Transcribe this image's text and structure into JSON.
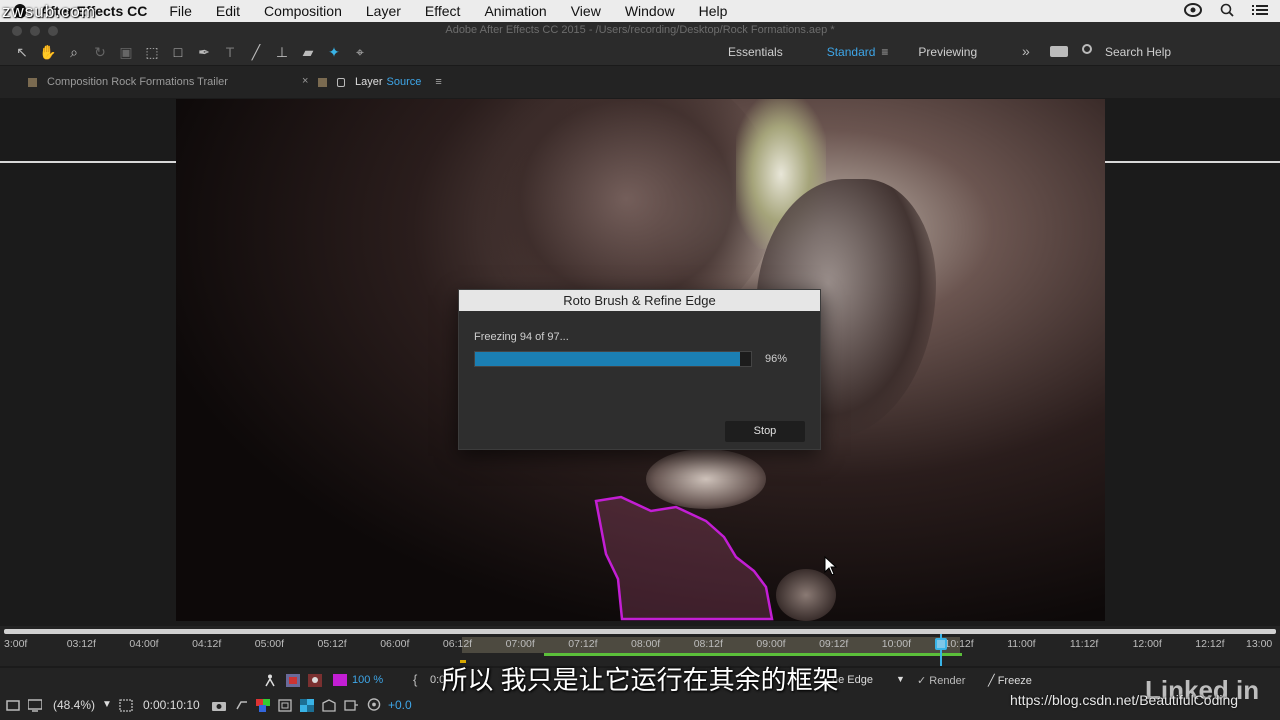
{
  "watermark": "zwsub.com",
  "menubar": {
    "app": "After Effects CC",
    "items": [
      "File",
      "Edit",
      "Composition",
      "Layer",
      "Effect",
      "Animation",
      "View",
      "Window",
      "Help"
    ]
  },
  "titlebar": {
    "title": "Adobe After Effects CC 2015 - /Users/recording/Desktop/Rock Formations.aep *"
  },
  "workspaces": {
    "items": [
      "Essentials",
      "Standard",
      "Previewing"
    ],
    "active": "Standard"
  },
  "search": {
    "label": "Search Help"
  },
  "tabs": {
    "composition": "Composition Rock Formations Trailer",
    "layer_prefix": "Layer",
    "layer_source": "Source"
  },
  "dialog": {
    "title": "Roto Brush & Refine Edge",
    "status": "Freezing 94 of 97...",
    "progress_fraction": 0.96,
    "progress_label": "96%",
    "stop_label": "Stop"
  },
  "timeline": {
    "ticks": [
      "3:00f",
      "03:12f",
      "04:00f",
      "04:12f",
      "05:00f",
      "05:12f",
      "06:00f",
      "06:12f",
      "07:00f",
      "07:12f",
      "08:00f",
      "08:12f",
      "09:00f",
      "09:12f",
      "10:00f",
      "10:12f",
      "11:00f",
      "11:12f",
      "12:00f",
      "12:12f",
      "13:00"
    ]
  },
  "controls": {
    "zoom_pct": "100 %",
    "timecode_partial": "0:0",
    "edge_label": "ne Edge",
    "render_label": "Render",
    "freeze_label": "Freeze",
    "view_zoom": "(48.4%)",
    "current_time": "0:00:10:10",
    "exposure": "+0.0"
  },
  "subtitle": "所以  我只是让它运行在其余的框架",
  "branding": {
    "linkedin": "Linked in",
    "csdn": "https://blog.csdn.net/BeautifulCoding"
  },
  "colors": {
    "accent_blue": "#3ea6e8",
    "progress_blue": "#1b7fb3",
    "roto_magenta": "#c31ed4",
    "cache_green": "#5bbf3a"
  }
}
